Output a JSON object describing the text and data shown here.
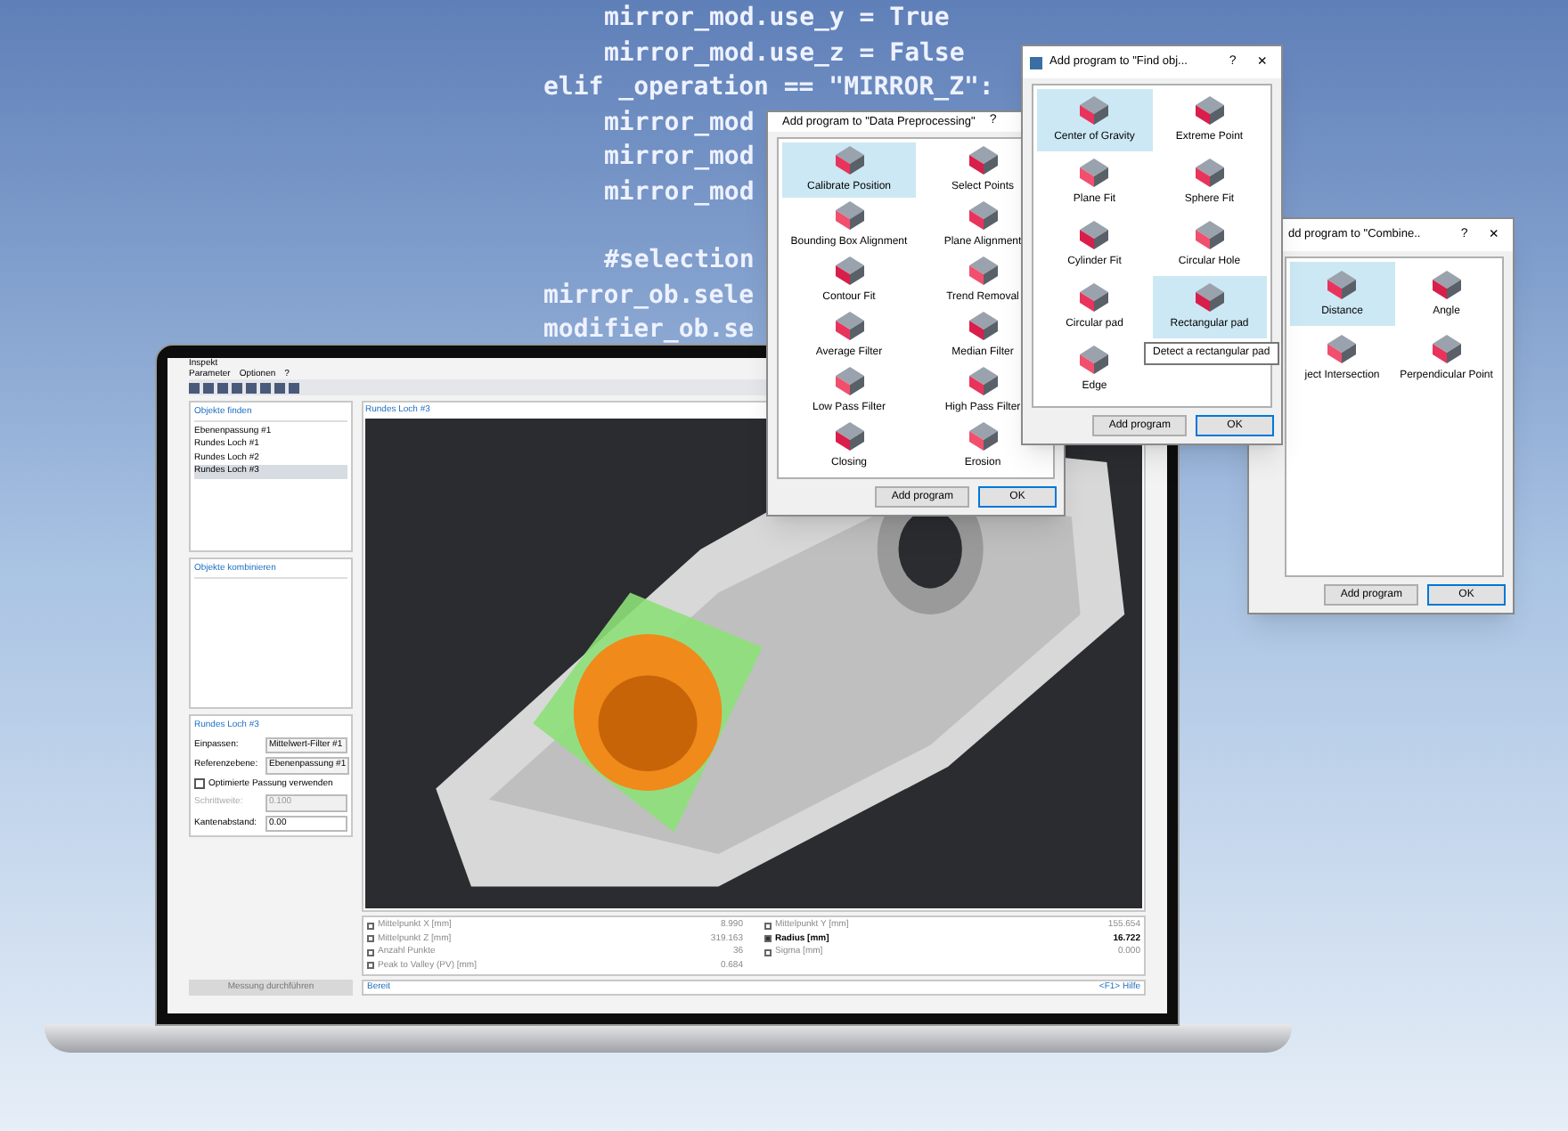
{
  "code_lines": [
    {
      "text": "mirror_mod.use_y = True",
      "indented": true
    },
    {
      "text": "mirror_mod.use_z = False",
      "indented": true
    },
    {
      "text": "elif _operation == \"MIRROR_Z\":",
      "indented": false
    },
    {
      "text": "mirror_mod",
      "indented": true
    },
    {
      "text": "mirror_mod",
      "indented": true
    },
    {
      "text": "mirror_mod",
      "indented": true
    },
    {
      "text": "#selection",
      "indented": true
    },
    {
      "text": "mirror_ob.sele",
      "indented": false
    },
    {
      "text": "modifier_ob.se",
      "indented": false
    }
  ],
  "app": {
    "title": "Inspekt",
    "menu": [
      "Parameter",
      "Optionen",
      "?"
    ],
    "panels": [
      {
        "title": "Objekte finden",
        "items": [
          {
            "label": "Ebenenpassung #1",
            "selected": false
          },
          {
            "label": "Rundes Loch #1",
            "selected": false
          },
          {
            "label": "Rundes Loch #2",
            "selected": false
          },
          {
            "label": "Rundes Loch #3",
            "selected": true
          }
        ]
      },
      {
        "title": "Objekte kombinieren"
      }
    ],
    "properties": {
      "title": "Rundes Loch #3",
      "fields": [
        {
          "label": "Einpassen:",
          "value": "Mittelwert-Filter #1"
        },
        {
          "label": "Referenzebene:",
          "value": "Ebenenpassung #1"
        }
      ],
      "option": {
        "label": "Optimierte Passung verwenden",
        "checked": false
      },
      "numbers": [
        {
          "label": "Schrittweite:",
          "value": "0.100",
          "disabled": true
        },
        {
          "label": "Kantenabstand:",
          "value": "0.00",
          "disabled": false
        }
      ]
    },
    "run_button": "Messung durchführen",
    "view_tab": "Rundes Loch #3",
    "results": [
      {
        "label": "Mittelpunkt X [mm]",
        "value": "8.990",
        "checked": false
      },
      {
        "label": "Mittelpunkt Y [mm]",
        "value": "155.654",
        "checked": false
      },
      {
        "label": "Mittelpunkt Z [mm]",
        "value": "319.163",
        "checked": false
      },
      {
        "label": "Radius [mm]",
        "value": "16.722",
        "checked": true
      },
      {
        "label": "Anzahl Punkte",
        "value": "36",
        "checked": false
      },
      {
        "label": "Sigma [mm]",
        "value": "0.000",
        "checked": false
      },
      {
        "label": "Peak to Valley (PV) [mm]",
        "value": "0.684",
        "checked": false
      }
    ],
    "status": "Bereit",
    "help": "<F1> Hilfe"
  },
  "dialogs": [
    {
      "title": "dd program to \"Combine..",
      "help": "?",
      "close": "×",
      "items": [
        {
          "label": "Distance",
          "selected": true
        },
        {
          "label": "Angle",
          "selected": false
        },
        {
          "label": "ject Intersection",
          "selected": false
        },
        {
          "label": "Perpendicular Point",
          "selected": false
        }
      ],
      "buttons": [
        "Add program",
        "OK"
      ]
    },
    {
      "title": "Add program to \"Data Preprocessing\"",
      "help": "?",
      "items": [
        {
          "label": "Calibrate Position",
          "selected": true
        },
        {
          "label": "Select Points",
          "selected": false
        },
        {
          "label": "Bounding Box Alignment",
          "selected": false
        },
        {
          "label": "Plane Alignment",
          "selected": false
        },
        {
          "label": "Contour Fit",
          "selected": false
        },
        {
          "label": "Trend Removal",
          "selected": false
        },
        {
          "label": "Average Filter",
          "selected": false
        },
        {
          "label": "Median Filter",
          "selected": false
        },
        {
          "label": "Low Pass Filter",
          "selected": false
        },
        {
          "label": "High Pass Filter",
          "selected": false
        },
        {
          "label": "Closing",
          "selected": false
        },
        {
          "label": "Erosion",
          "selected": false
        }
      ],
      "buttons": [
        "Add program",
        "OK"
      ]
    },
    {
      "title": "Add program to \"Find obj...",
      "help": "?",
      "close": "×",
      "items": [
        {
          "label": "Center of Gravity",
          "selected": true
        },
        {
          "label": "Extreme Point",
          "selected": false
        },
        {
          "label": "Plane Fit",
          "selected": false
        },
        {
          "label": "Sphere Fit",
          "selected": false
        },
        {
          "label": "Cylinder Fit",
          "selected": false
        },
        {
          "label": "Circular Hole",
          "selected": false
        },
        {
          "label": "Circular pad",
          "selected": false
        },
        {
          "label": "Rectangular pad",
          "selected": true
        },
        {
          "label": "Edge",
          "selected": false
        }
      ],
      "buttons": [
        "Add program",
        "OK"
      ],
      "tooltip": "Detect a rectangular pad"
    }
  ]
}
